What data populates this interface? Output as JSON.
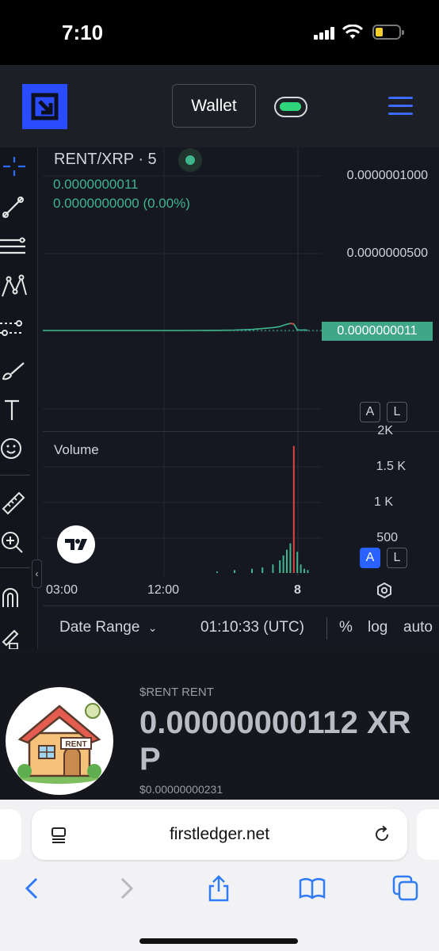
{
  "status_bar": {
    "time": "7:10"
  },
  "header": {
    "wallet_label": "Wallet"
  },
  "chart": {
    "pair_title": "RENT/XRP · 5",
    "ohlc_price": "0.0000000011",
    "ohlc_change": "0.0000000000 (0.00%)",
    "price_axis": [
      "0.0000001000",
      "0.0000000500"
    ],
    "last_price": "0.0000000011",
    "volume_label": "Volume",
    "volume_axis": [
      "2K",
      "1.5 K",
      "1 K",
      "500"
    ],
    "price_scale_buttons": {
      "auto": "A",
      "log": "L"
    },
    "volume_scale_buttons": {
      "auto": "A",
      "log": "L"
    },
    "time_axis": [
      "03:00",
      "12:00",
      "8"
    ],
    "bottom_bar": {
      "date_range": "Date Range",
      "clock": "01:10:33 (UTC)",
      "percent": "%",
      "log": "log",
      "auto": "auto"
    },
    "colors": {
      "up": "#3fb58f",
      "down": "#e0443c",
      "accent": "#2962ff"
    }
  },
  "chart_data": {
    "type": "line",
    "title": "RENT/XRP · 5",
    "ylabel": "",
    "xlabel": "",
    "x_ticks": [
      "03:00",
      "12:00",
      "8"
    ],
    "y_ticks": [
      "0.0000001000",
      "0.0000000500"
    ],
    "ylim": [
      0,
      1.2e-07
    ],
    "series": [
      {
        "name": "RENT/XRP",
        "x": [
          0,
          10,
          20,
          30,
          40,
          50,
          55,
          60,
          63,
          66,
          68,
          69,
          70,
          71,
          72,
          73,
          74,
          75,
          76
        ],
        "values": [
          0.0,
          0.0,
          0.0,
          0.0,
          0.0,
          1e-10,
          3e-10,
          8e-10,
          1.5e-09,
          2.2e-09,
          3e-09,
          4e-09,
          4.8e-09,
          5.5e-09,
          5e-09,
          5e-10,
          3e-10,
          4e-10,
          2e-10
        ]
      }
    ],
    "last_value": "0.0000000011",
    "volume_ticks": [
      "2K",
      "1.5 K",
      "1 K",
      "500"
    ],
    "volume": [
      0,
      0,
      0,
      0,
      0,
      20,
      40,
      60,
      80,
      120,
      180,
      250,
      330,
      420,
      1800,
      300,
      120,
      60,
      40
    ]
  },
  "token": {
    "ticker": "$RENT RENT",
    "price": "0.00000000112 XRP",
    "usd_price": "$0.00000000231",
    "avatar_sign": "RENT"
  },
  "browser": {
    "url": "firstledger.net"
  }
}
